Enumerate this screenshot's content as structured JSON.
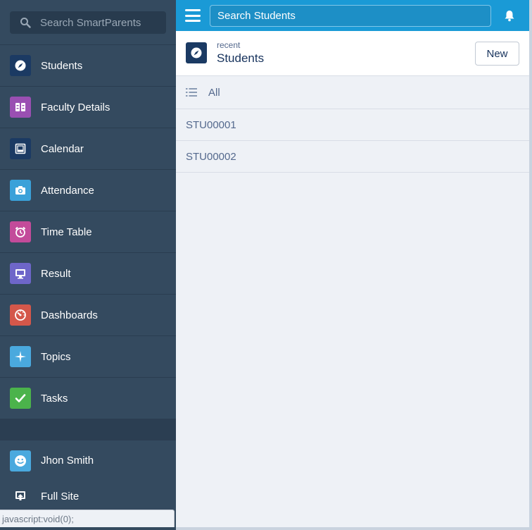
{
  "sidebar": {
    "search_placeholder": "Search SmartParents",
    "items": [
      {
        "label": "Students",
        "icon": "compass-icon",
        "color": "#1b3a63"
      },
      {
        "label": "Faculty Details",
        "icon": "books-icon",
        "color": "#9a4fb2"
      },
      {
        "label": "Calendar",
        "icon": "calendar-icon",
        "color": "#1b3a63"
      },
      {
        "label": "Attendance",
        "icon": "camera-icon",
        "color": "#3aa1d9"
      },
      {
        "label": "Time Table",
        "icon": "alarm-clock-icon",
        "color": "#c34b9a"
      },
      {
        "label": "Result",
        "icon": "monitor-icon",
        "color": "#6e66c9"
      },
      {
        "label": "Dashboards",
        "icon": "gauge-icon",
        "color": "#d4574a"
      },
      {
        "label": "Topics",
        "icon": "sparkle-icon",
        "color": "#4aa9de"
      },
      {
        "label": "Tasks",
        "icon": "checkmark-icon",
        "color": "#4bb34b"
      }
    ],
    "user": {
      "label": "Jhon Smith",
      "icon": "smiley-icon",
      "color": "#4aa9de"
    },
    "full_site": {
      "label": "Full Site",
      "icon": "full-site-icon"
    },
    "status_text": "javascript:void(0);"
  },
  "topbar": {
    "search_placeholder": "Search Students"
  },
  "header": {
    "subtitle": "recent",
    "title": "Students",
    "new_button": "New"
  },
  "filter": {
    "label": "All"
  },
  "records": [
    "STU00001",
    "STU00002"
  ],
  "colors": {
    "sidebar_bg": "#344a5f",
    "topbar_bg": "#1a9ad6",
    "main_bg": "#eef1f6"
  }
}
